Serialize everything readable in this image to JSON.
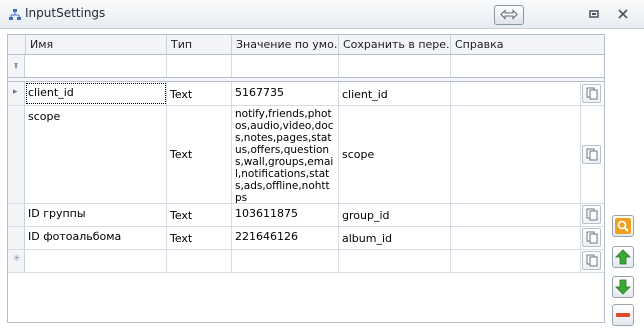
{
  "window": {
    "title": "InputSettings",
    "icons": {
      "app": "tree-icon",
      "split": "split-arrows-icon",
      "restore": "restore-icon",
      "close": "close-icon"
    }
  },
  "grid": {
    "columns": [
      "Имя",
      "Тип",
      "Значение по умо...",
      "Сохранить в пере...",
      "Справка"
    ],
    "rows": [
      {
        "name": "client_id",
        "type": "Text",
        "value": "5167735",
        "save_to": "client_id",
        "help": ""
      },
      {
        "name": "scope",
        "type": "Text",
        "value": "notify,friends,photos,audio,video,docs,notes,pages,status,offers,questions,wall,groups,email,notifications,stats,ads,offline,nohttps",
        "save_to": "scope",
        "help": ""
      },
      {
        "name": "ID группы",
        "type": "Text",
        "value": "103611875",
        "save_to": "group_id",
        "help": ""
      },
      {
        "name": "ID фотоальбома",
        "type": "Text",
        "value": "221646126",
        "save_to": "album_id",
        "help": ""
      }
    ],
    "row_action_icon": "document-copy-icon",
    "new_row_icon": "asterisk-icon",
    "filter_icon": "pin-filter-icon"
  },
  "side_buttons": [
    {
      "name": "search-button",
      "icon": "magnifier-icon",
      "color": "#f0a020"
    },
    {
      "name": "move-up-button",
      "icon": "arrow-up-icon",
      "color": "#3aa832"
    },
    {
      "name": "move-down-button",
      "icon": "arrow-down-icon",
      "color": "#3aa832"
    },
    {
      "name": "remove-button",
      "icon": "minus-icon",
      "color": "#e04a2a"
    }
  ]
}
